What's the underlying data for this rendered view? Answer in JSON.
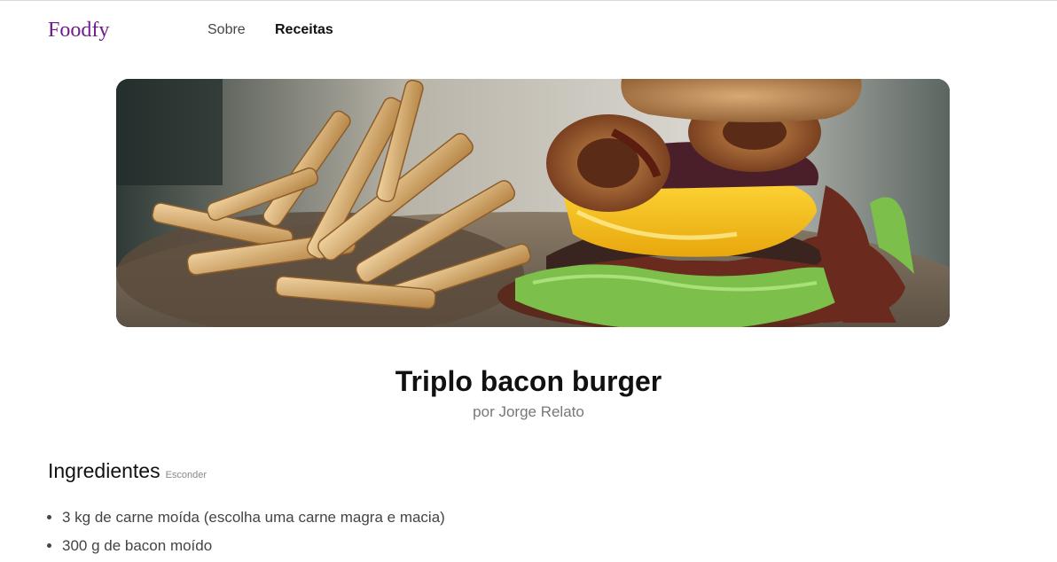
{
  "header": {
    "logo": "Foodfy",
    "nav": [
      {
        "label": "Sobre",
        "active": false
      },
      {
        "label": "Receitas",
        "active": true
      }
    ]
  },
  "recipe": {
    "title": "Triplo bacon burger",
    "author": "por Jorge Relato",
    "image_icon": "burger-photo"
  },
  "ingredients": {
    "title": "Ingredientes",
    "toggle_label": "Esconder",
    "items": [
      "3 kg de carne moída (escolha uma carne magra e macia)",
      "300 g de bacon moído"
    ]
  },
  "colors": {
    "brand": "#6c1d8a",
    "text": "#111111",
    "muted": "#777777"
  }
}
